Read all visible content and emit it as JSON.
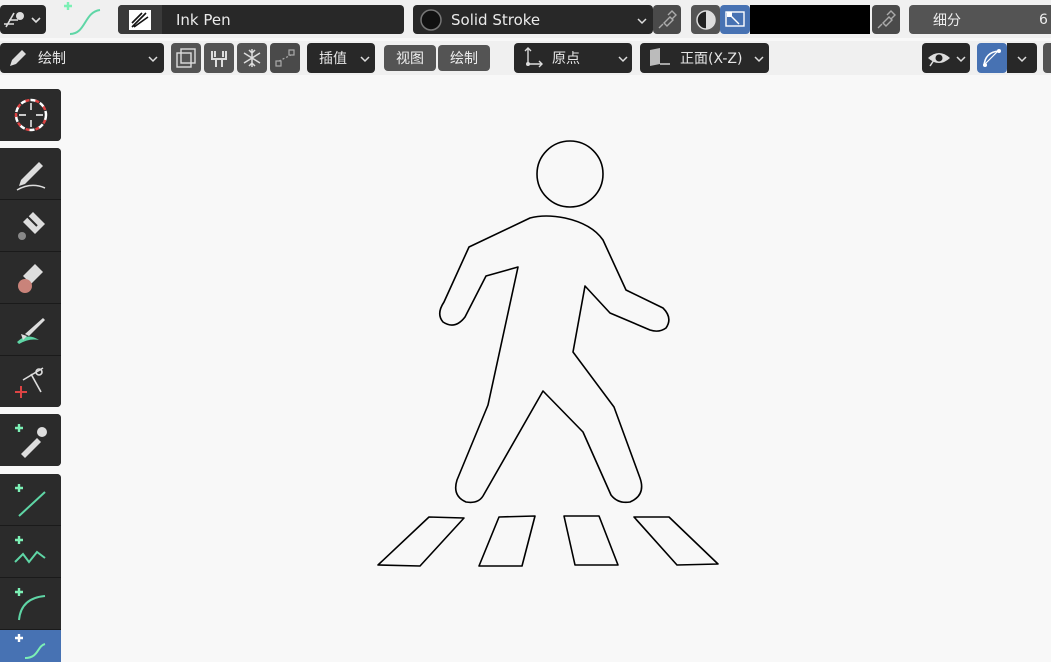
{
  "header": {
    "brush_name": "Ink Pen",
    "material_name": "Solid Stroke",
    "subdivision_label": "细分",
    "subdivision_value": "6"
  },
  "toolbar": {
    "mode_label": "绘制",
    "interpolate_label": "插值",
    "view_label": "视图",
    "draw_label": "绘制",
    "origin_label": "原点",
    "plane_label": "正面(X-Z)"
  },
  "tools": [
    {
      "icon": "cursor-icon"
    },
    {
      "icon": "draw-icon"
    },
    {
      "icon": "fill-icon"
    },
    {
      "icon": "erase-icon"
    },
    {
      "icon": "tint-icon"
    },
    {
      "icon": "cutter-icon"
    },
    {
      "icon": "eyedropper-icon"
    },
    {
      "icon": "line-icon"
    },
    {
      "icon": "polyline-icon"
    },
    {
      "icon": "arc-icon"
    },
    {
      "icon": "curve-icon"
    }
  ],
  "colors": {
    "accent": "#4772b3",
    "stroke_green": "#5fd6a6",
    "plus_green": "#7cf0b5"
  }
}
